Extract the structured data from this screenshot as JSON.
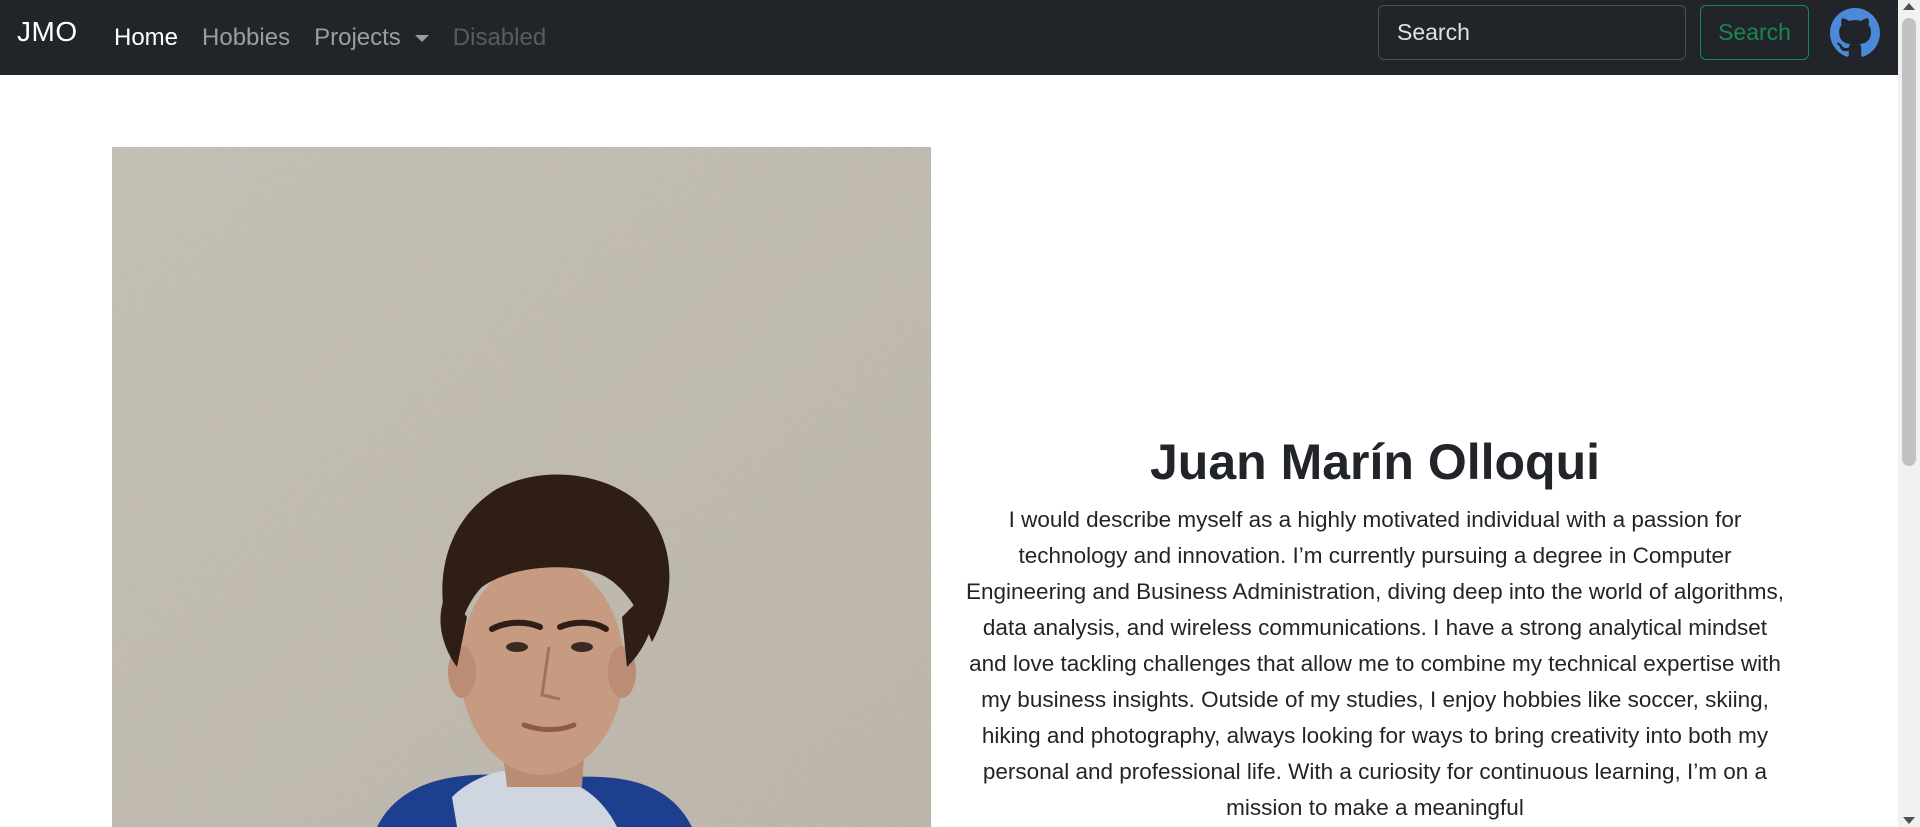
{
  "navbar": {
    "brand": "JMO",
    "links": [
      {
        "label": "Home",
        "state": "active"
      },
      {
        "label": "Hobbies",
        "state": "default"
      },
      {
        "label": "Projects",
        "state": "dropdown"
      },
      {
        "label": "Disabled",
        "state": "disabled"
      }
    ],
    "search": {
      "placeholder": "Search",
      "value": "",
      "button_label": "Search"
    },
    "github_icon": "github-icon"
  },
  "hero": {
    "photo_icon": "portrait-photo",
    "name": "Juan Marín Olloqui",
    "bio": "I would describe myself as a highly motivated individual with a passion for technology and innovation. I’m currently pursuing a degree in Computer Engineering and Business Administration, diving deep into the world of algorithms, data analysis, and wireless communications. I have a strong analytical mindset and love tackling challenges that allow me to combine my technical expertise with my business insights. Outside of my studies, I enjoy hobbies like soccer, skiing, hiking and photography, always looking for ways to bring creativity into both my personal and professional life. With a curiosity for continuous learning, I’m on a mission to make a meaningful"
  },
  "colors": {
    "navbar_bg": "#212529",
    "accent_green": "#198754",
    "text": "#212529",
    "wall": "#c6c0b5",
    "hoodie": "#1e3f8f",
    "hair": "#2e1e16",
    "skin": "#c79a82"
  }
}
